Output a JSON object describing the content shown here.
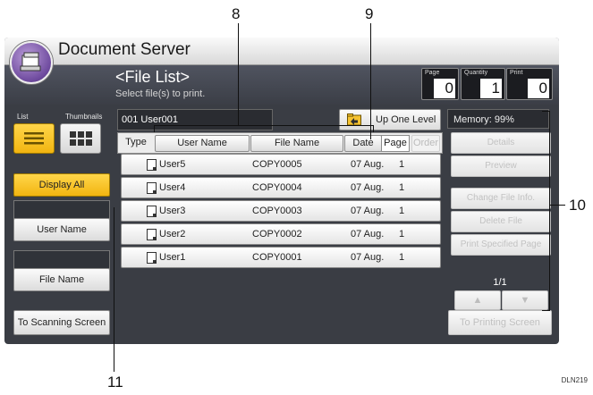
{
  "app": {
    "title": "Document Server",
    "icon": "document-server-icon"
  },
  "header": {
    "title": "<File List>",
    "subtitle": "Select file(s) to print."
  },
  "counters": [
    {
      "label": "Page",
      "value": "0"
    },
    {
      "label": "Quantity",
      "value": "1"
    },
    {
      "label": "Print",
      "value": "0"
    }
  ],
  "view": {
    "list_label": "List",
    "thumbnails_label": "Thumbnails"
  },
  "filters": {
    "display_all": "Display All",
    "user_name": "User Name",
    "file_name": "File Name"
  },
  "to_scanning": "To Scanning Screen",
  "path": "001 User001",
  "up_one_level": "Up One Level",
  "sort": {
    "type": "Type",
    "user_name": "User Name",
    "file_name": "File Name",
    "date": "Date",
    "page": "Page",
    "order": "Order"
  },
  "files": [
    {
      "user": "User5",
      "file": "COPY0005",
      "date": "07 Aug.",
      "pages": "1"
    },
    {
      "user": "User4",
      "file": "COPY0004",
      "date": "07 Aug.",
      "pages": "1"
    },
    {
      "user": "User3",
      "file": "COPY0003",
      "date": "07 Aug.",
      "pages": "1"
    },
    {
      "user": "User2",
      "file": "COPY0002",
      "date": "07 Aug.",
      "pages": "1"
    },
    {
      "user": "User1",
      "file": "COPY0001",
      "date": "07 Aug.",
      "pages": "1"
    }
  ],
  "memory": "Memory: 99%",
  "right_buttons": {
    "details": "Details",
    "preview": "Preview",
    "change_file_info": "Change File Info.",
    "delete_file": "Delete File",
    "print_specified_page": "Print Specified Page"
  },
  "pager": {
    "label": "1/1",
    "up": "▲",
    "down": "▼"
  },
  "to_printing": "To Printing Screen",
  "callouts": {
    "c8": "8",
    "c9": "9",
    "c10": "10",
    "c11": "11"
  },
  "figure_code": "DLN219",
  "colors": {
    "accent_yellow": "#f2b511",
    "panel_dark": "#3a3d44"
  }
}
